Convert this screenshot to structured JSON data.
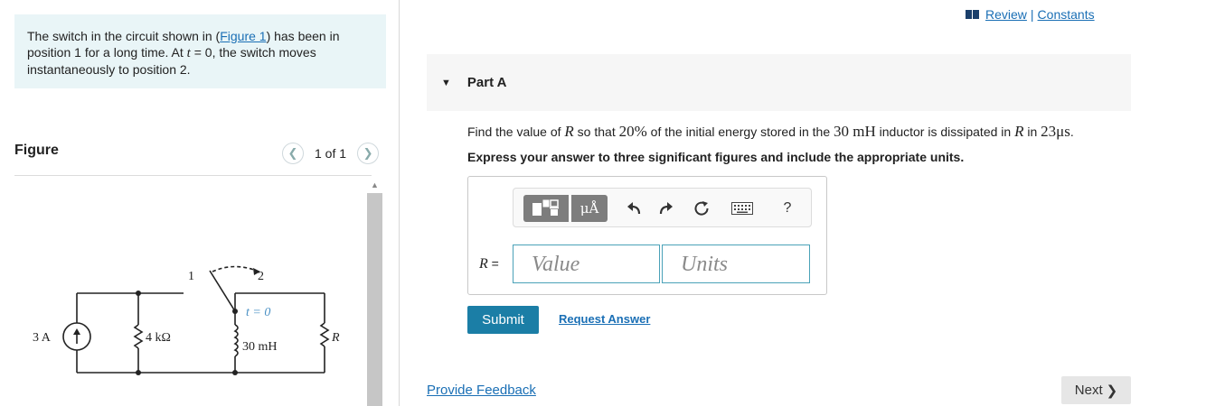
{
  "problem": {
    "text_before": "The switch in the circuit shown in (",
    "figure_link": "Figure 1",
    "text_after_1": ") has been in position 1 for a long time. At ",
    "t_var": "t",
    "text_after_2": " = 0, the switch moves instantaneously to position 2."
  },
  "figure": {
    "title": "Figure",
    "pager": "1 of 1",
    "circuit": {
      "source": "3 A",
      "r1": "4 kΩ",
      "inductor": "30 mH",
      "r2": "R",
      "switch_pos1": "1",
      "switch_pos2": "2",
      "switch_time": "t = 0"
    }
  },
  "header": {
    "review": "Review",
    "separator": "|",
    "constants": "Constants"
  },
  "part": {
    "title": "Part A",
    "q1": "Find the value of ",
    "q_var": "R",
    "q2": " so that ",
    "q_pct": "20%",
    "q3": " of the initial energy stored in the ",
    "q_ind": "30 mH",
    "q4": " inductor is dissipated in ",
    "q5": " in ",
    "q_time": "23μs",
    "q6": ".",
    "instruction": "Express your answer to three significant figures and include the appropriate units."
  },
  "toolbar": {
    "units_label": "μÅ",
    "help_label": "?",
    "icons": [
      "templates-icon",
      "units-icon",
      "undo-icon",
      "redo-icon",
      "reset-icon",
      "keyboard-icon",
      "help-icon"
    ]
  },
  "answer": {
    "var": "R",
    "eq": " =",
    "value_placeholder": "Value",
    "units_placeholder": "Units"
  },
  "buttons": {
    "submit": "Submit",
    "request_answer": "Request Answer",
    "next": "Next"
  },
  "footer": {
    "feedback": "Provide Feedback"
  },
  "colors": {
    "accent": "#1b7ea6",
    "problem_bg": "#e9f5f7",
    "link": "#1a6fb5"
  }
}
